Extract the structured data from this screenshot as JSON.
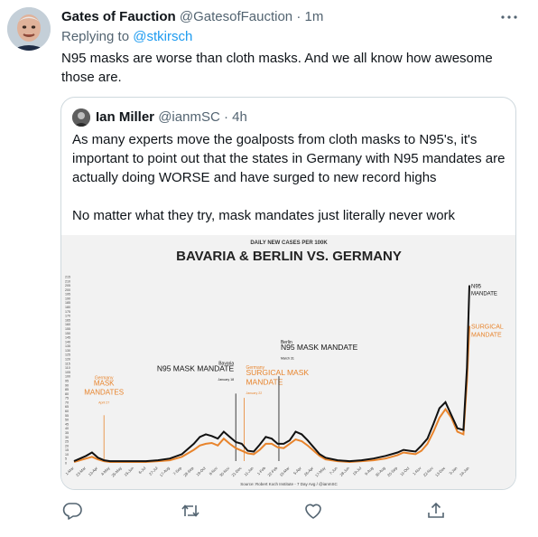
{
  "tweet": {
    "author_name": "Gates of Fauction",
    "author_handle": "@GatesofFauction",
    "separator": "·",
    "time": "1m",
    "reply_prefix": "Replying to",
    "reply_to": "@stkirsch",
    "text": "N95 masks are worse than cloth masks. And we all know how awesome those are."
  },
  "quote": {
    "author_name": "Ian Miller",
    "author_handle": "@ianmSC",
    "separator": "·",
    "time": "4h",
    "paragraph1": "As many experts move the goalposts from cloth masks to N95's, it's important to point out that the states in Germany with N95 mandates are actually doing WORSE and have surged to new record highs",
    "paragraph2": "No matter what they try, mask mandates just literally never work"
  },
  "chart_data": {
    "type": "line",
    "subtitle": "DAILY NEW CASES PER 100K",
    "title": "BAVARIA & BERLIN VS. GERMANY",
    "source": "Source: Robert Koch Institute - 7 Day Avg / @ianmSC",
    "ylim": [
      0,
      215
    ],
    "y_ticks": [
      "0",
      "5",
      "10",
      "15",
      "20",
      "25",
      "30",
      "35",
      "40",
      "45",
      "50",
      "55",
      "60",
      "65",
      "70",
      "75",
      "80",
      "85",
      "90",
      "95",
      "100",
      "105",
      "110",
      "115",
      "120",
      "125",
      "130",
      "135",
      "140",
      "145",
      "150",
      "155",
      "160",
      "165",
      "170",
      "175",
      "180",
      "185",
      "190",
      "195",
      "200",
      "205",
      "210",
      "215"
    ],
    "x_ticks": [
      "1-Mar",
      "23-Mar",
      "13-Apr",
      "4-May",
      "25-May",
      "15-Jun",
      "6-Jul",
      "27-Jul",
      "17-Aug",
      "7-Sep",
      "28-Sep",
      "19-Oct",
      "9-Nov",
      "30-Nov",
      "21-Dec",
      "11-Jan",
      "1-Feb",
      "22-Feb",
      "15-Mar",
      "5-Apr",
      "26-Apr",
      "17-May",
      "7-Jun",
      "28-Jun",
      "19-Jul",
      "9-Aug",
      "30-Aug",
      "20-Sep",
      "11-Oct",
      "1-Nov",
      "22-Nov",
      "13-Dec",
      "3-Jan",
      "24-Jan"
    ],
    "colors": {
      "bavaria_berlin": "#111111",
      "germany": "#e8842c",
      "background": "#f2f2f2"
    },
    "series": [
      {
        "name": "Bavaria & Berlin",
        "color": "#111111",
        "x": [
          0,
          1,
          1.5,
          2,
          2.5,
          3,
          4,
          5,
          6,
          7,
          8,
          9,
          10,
          10.5,
          11,
          11.5,
          12,
          12.5,
          13,
          13.5,
          14,
          14.5,
          15,
          15.5,
          16,
          16.5,
          17,
          17.5,
          18,
          18.5,
          19,
          19.5,
          20,
          20.5,
          21,
          22,
          23,
          24,
          25,
          26,
          27,
          27.5,
          28,
          28.5,
          29,
          29.5,
          30,
          30.5,
          31,
          31.5,
          32,
          32.5,
          32.8,
          33
        ],
        "y": [
          2,
          8,
          12,
          6,
          3,
          2,
          2,
          2,
          2,
          3,
          5,
          10,
          22,
          30,
          33,
          31,
          28,
          36,
          30,
          24,
          22,
          14,
          13,
          21,
          30,
          28,
          22,
          22,
          26,
          36,
          33,
          26,
          18,
          10,
          6,
          3,
          2,
          3,
          5,
          8,
          12,
          15,
          14,
          13,
          20,
          28,
          45,
          63,
          70,
          55,
          40,
          38,
          110,
          205
        ]
      },
      {
        "name": "Germany",
        "color": "#e8842c",
        "x": [
          0,
          1,
          1.5,
          2,
          2.5,
          3,
          4,
          5,
          6,
          7,
          8,
          9,
          10,
          10.5,
          11,
          11.5,
          12,
          12.5,
          13,
          13.5,
          14,
          14.5,
          15,
          15.5,
          16,
          16.5,
          17,
          17.5,
          18,
          18.5,
          19,
          19.5,
          20,
          20.5,
          21,
          22,
          23,
          24,
          25,
          26,
          27,
          27.5,
          28,
          28.5,
          29,
          29.5,
          30,
          30.5,
          31,
          31.5,
          32,
          32.5,
          32.8,
          33
        ],
        "y": [
          1,
          5,
          7,
          4,
          2,
          1,
          1,
          1,
          1,
          2,
          3,
          7,
          15,
          20,
          22,
          23,
          20,
          28,
          22,
          17,
          14,
          11,
          10,
          15,
          22,
          22,
          18,
          17,
          22,
          27,
          25,
          20,
          14,
          8,
          4,
          2,
          1,
          2,
          3,
          5,
          9,
          12,
          11,
          10,
          14,
          22,
          36,
          52,
          62,
          52,
          36,
          33,
          95,
          158
        ]
      }
    ],
    "annotations": [
      {
        "x": 2.5,
        "lines": [
          "Germany",
          "MASK",
          "MANDATES"
        ],
        "sub": "April 27",
        "color": "#e8842c",
        "y_value": 55
      },
      {
        "x": 13.5,
        "lines": [
          "Bavaria",
          "N95 MASK MANDATE"
        ],
        "sub": "January 18",
        "color": "#111111",
        "y_value": 80
      },
      {
        "x": 14.2,
        "lines": [
          "Germany",
          "SURGICAL MASK",
          "MANDATE"
        ],
        "sub": "January 22",
        "color": "#e8842c",
        "y_value": 75
      },
      {
        "x": 17.1,
        "lines": [
          "Berlin",
          "N95 MASK MANDATE"
        ],
        "sub": "March 31",
        "color": "#111111",
        "y_value": 100
      },
      {
        "x": 33,
        "lines": [
          "N95",
          "MANDATE"
        ],
        "sub": "",
        "color": "#111111",
        "y_value": 205
      },
      {
        "x": 33,
        "lines": [
          "SURGICAL",
          "MANDATE"
        ],
        "sub": "",
        "color": "#e8842c",
        "y_value": 158
      }
    ]
  },
  "actions": {
    "reply": "reply-icon",
    "retweet": "retweet-icon",
    "like": "like-icon",
    "share": "share-icon"
  }
}
